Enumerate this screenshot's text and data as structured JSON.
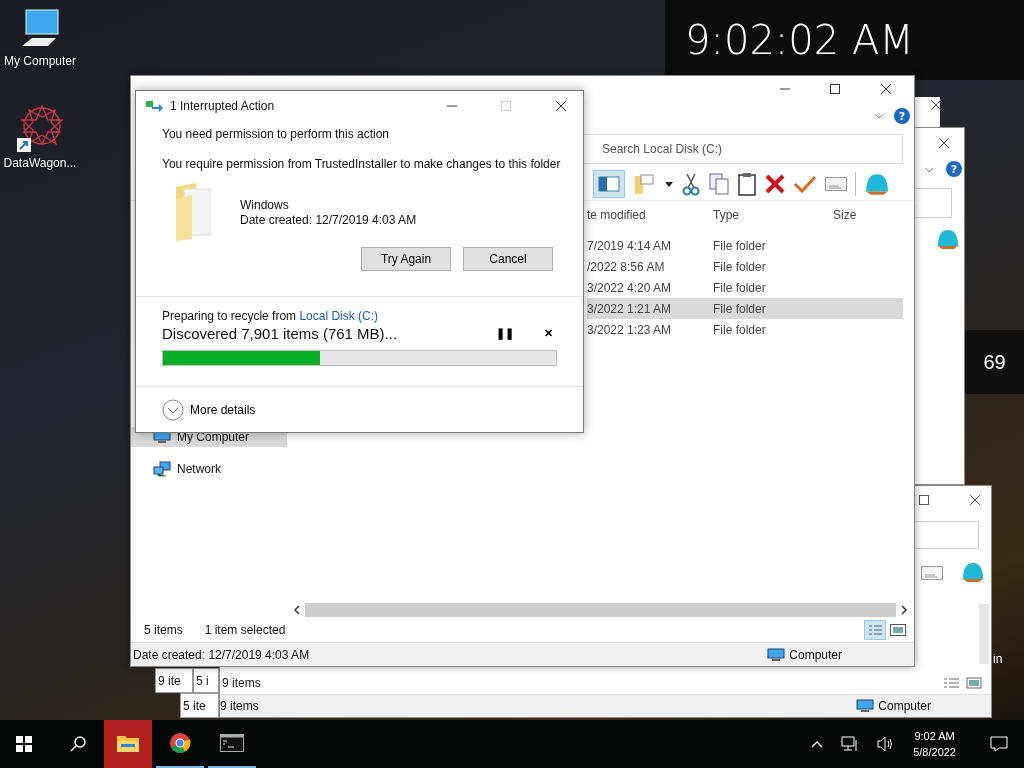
{
  "desktop_icons": [
    {
      "label": "My Computer",
      "kind": "computer"
    },
    {
      "label": "DataWagon...",
      "kind": "shortcut"
    }
  ],
  "desktop_label_cut": "in",
  "clock": {
    "time": "9:02:02 AM"
  },
  "weather_widget": {
    "value": "69"
  },
  "stacked_windows": [
    {
      "status": "9 ite"
    },
    {
      "status": "5 i"
    },
    {
      "status": "5 ite"
    }
  ],
  "back_window": {
    "help": "?",
    "status": "9 items",
    "details": "9 items",
    "location": "Computer"
  },
  "explorer": {
    "help": "?",
    "search_placeholder": "Search Local Disk (C:)",
    "columns": [
      "te modified",
      "Type",
      "Size"
    ],
    "rows": [
      {
        "modified": "7/2019 4:14 AM",
        "type": "File folder",
        "selected": false
      },
      {
        "modified": "/2022 8:56 AM",
        "type": "File folder",
        "selected": false
      },
      {
        "modified": "3/2022 4:20 AM",
        "type": "File folder",
        "selected": false
      },
      {
        "modified": "3/2022 1:21 AM",
        "type": "File folder",
        "selected": true
      },
      {
        "modified": "3/2022 1:23 AM",
        "type": "File folder",
        "selected": false
      }
    ],
    "nav": [
      {
        "label": "My Computer",
        "kind": "computer",
        "selected": true
      },
      {
        "label": "Network",
        "kind": "network",
        "selected": false
      }
    ],
    "status": {
      "count": "5 items",
      "selection": "1 item selected"
    },
    "details": {
      "text": "Date created: 12/7/2019 4:03 AM",
      "location": "Computer"
    }
  },
  "dialog": {
    "title": "1 Interrupted Action",
    "heading": "You need permission to perform this action",
    "message": "You require permission from TrustedInstaller to make changes to this folder",
    "file": {
      "name": "Windows",
      "date": "Date created: 12/7/2019 4:03 AM"
    },
    "buttons": [
      "Try Again",
      "Cancel"
    ],
    "progress": {
      "prefix": "Preparing to recycle from",
      "link": "Local Disk (C:)",
      "status": "Discovered 7,901 items (761 MB)...",
      "pause": "❚❚",
      "cancel": "✕",
      "level": 0.4
    },
    "more_details": "More details"
  },
  "taskbar": {
    "apps": [
      {
        "kind": "explorer",
        "selected": true,
        "running": true
      },
      {
        "kind": "chrome",
        "selected": false,
        "running": true
      },
      {
        "kind": "terminal",
        "selected": false,
        "running": true
      }
    ],
    "time": "9:02 AM",
    "date": "5/8/2022"
  }
}
